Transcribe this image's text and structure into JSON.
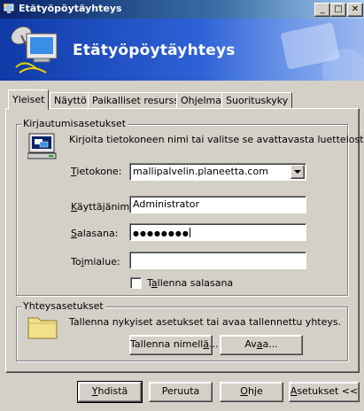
{
  "window": {
    "title": "Etätyöpöytäyhteys",
    "minimize_glyph": "_",
    "maximize_glyph": "□",
    "close_glyph": "✕"
  },
  "banner": {
    "title": "Etätyöpöytäyhteys"
  },
  "tabs": [
    {
      "label": "Yleiset",
      "active": true
    },
    {
      "label": "Näyttö"
    },
    {
      "label": "Paikalliset resurssit"
    },
    {
      "label": "Ohjelma"
    },
    {
      "label": "Suorituskyky"
    }
  ],
  "login": {
    "legend": "Kirjautumisasetukset",
    "description": "Kirjoita tietokoneen nimi tai valitse se avattavasta luettelosta.",
    "computer_label_pre": "",
    "computer_label_acc": "T",
    "computer_label_post": "ietokone:",
    "computer_value": "mallipalvelin.planeetta.com",
    "user_label_pre": "",
    "user_label_acc": "K",
    "user_label_post": "äyttäjänimi:",
    "user_value": "Administrator",
    "password_label_pre": "",
    "password_label_acc": "S",
    "password_label_post": "alasana:",
    "password_value": "●●●●●●●●",
    "domain_label_pre": "To",
    "domain_label_acc": "i",
    "domain_label_post": "mialue:",
    "domain_value": "",
    "save_pw_pre": "T",
    "save_pw_acc": "a",
    "save_pw_post": "llenna salasana",
    "save_pw_checked": false
  },
  "connection": {
    "legend": "Yhteysasetukset",
    "description": "Tallenna nykyiset asetukset tai avaa tallennettu yhteys.",
    "save_as_pre": "Tallenna nimell",
    "save_as_acc": "ä",
    "save_as_post": "...",
    "open_pre": "Av",
    "open_acc": "a",
    "open_post": "a..."
  },
  "buttons": {
    "connect_pre": "",
    "connect_acc": "Y",
    "connect_post": "hdistä",
    "cancel": "Peruuta",
    "help_pre": "",
    "help_acc": "O",
    "help_post": "hje",
    "options_pre": "",
    "options_acc": "A",
    "options_post": "setukset <<"
  },
  "colors": {
    "title_bar": "#0a246a",
    "banner": "#2e62d6",
    "face": "#d4d0c8"
  },
  "icons": {
    "app": "remote-desktop-icon",
    "computer": "computer-icon",
    "folder": "folder-icon"
  }
}
